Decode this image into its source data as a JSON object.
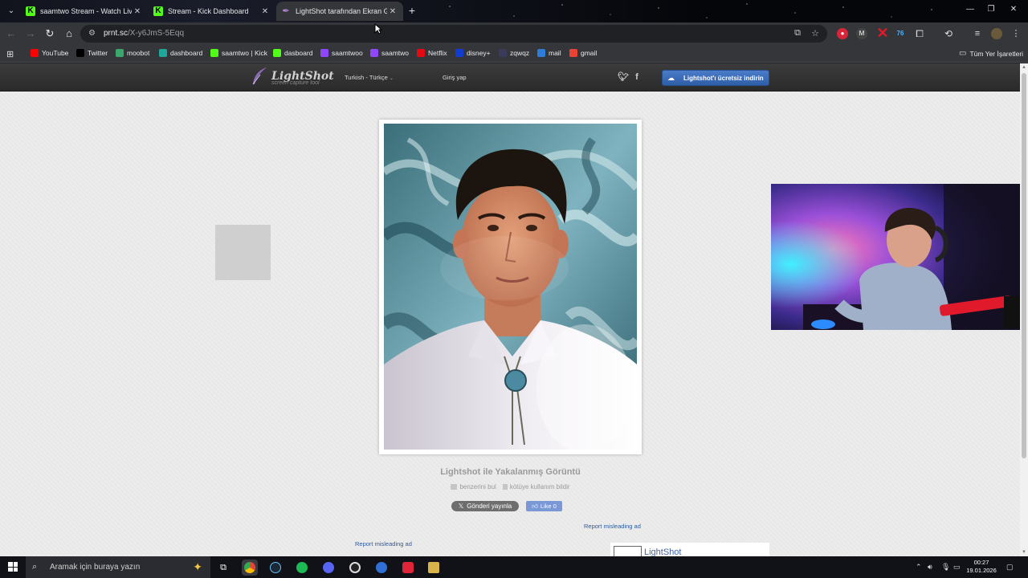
{
  "browser": {
    "tabs": [
      {
        "title": "saamtwo Stream - Watch Live o",
        "favicon": "kick-icon",
        "close": "✕"
      },
      {
        "title": "Stream - Kick Dashboard",
        "favicon": "kick-icon",
        "close": "✕"
      },
      {
        "title": "LightShot tarafından Ekran Gö",
        "favicon": "lightshot-feather-icon",
        "close": "✕",
        "active": true
      }
    ],
    "new_tab": "+",
    "url_host": "prnt.sc",
    "url_path": "/X-y6JmS-5Eqq",
    "extension_badge": "76",
    "bookmarks": [
      {
        "label": "YouTube",
        "icon": "youtube-icon",
        "color": "#ff0000"
      },
      {
        "label": "Twitter",
        "icon": "x-icon",
        "color": "#000000"
      },
      {
        "label": "moobot",
        "icon": "moobot-icon",
        "color": "#3aa76d"
      },
      {
        "label": "dashboard",
        "icon": "dashboard-icon",
        "color": "#21a79a"
      },
      {
        "label": "saamtwo | Kick",
        "icon": "kick-icon",
        "color": "#53fc18"
      },
      {
        "label": "dasboard",
        "icon": "kick-icon",
        "color": "#53fc18"
      },
      {
        "label": "saamtwoo",
        "icon": "twitch-icon",
        "color": "#9146ff"
      },
      {
        "label": "saamtwo",
        "icon": "twitch-icon",
        "color": "#9146ff"
      },
      {
        "label": "Netflix",
        "icon": "netflix-icon",
        "color": "#e50914"
      },
      {
        "label": "disney+",
        "icon": "disney-icon",
        "color": "#113ccf"
      },
      {
        "label": "zqwqz",
        "icon": "zk-icon",
        "color": "#3a3a5a"
      },
      {
        "label": "mail",
        "icon": "mail-icon",
        "color": "#2f7bd8"
      },
      {
        "label": "gmail",
        "icon": "gmail-icon",
        "color": "#ea4335"
      }
    ],
    "all_bookmarks": "Tüm Yer İşaretleri"
  },
  "lightshot": {
    "logo": "LightShot",
    "tagline": "screen capture tool",
    "language": "Turkish - Türkçe",
    "login": "Giriş yap",
    "download_button": "Lightshot'ı ücretsiz indirin",
    "caption_title": "Lightshot ile Yakalanmış Görüntü",
    "find_similar": "benzerini bul",
    "report_abuse": "kötüye kullanım bildir",
    "share_x": "Gönderi yayınla",
    "like": "Like 0",
    "report_ad_1": "Report misleading ad",
    "report_ad_2": "Report misleading ad",
    "promo": "LightShot"
  },
  "taskbar": {
    "search_placeholder": "Aramak için buraya yazın",
    "time": "00:27",
    "date": "19.01.2026"
  },
  "colors": {
    "accent_blue": "#2f5ea8",
    "kick_green": "#53fc18",
    "link_blue": "#2d5b9a"
  }
}
